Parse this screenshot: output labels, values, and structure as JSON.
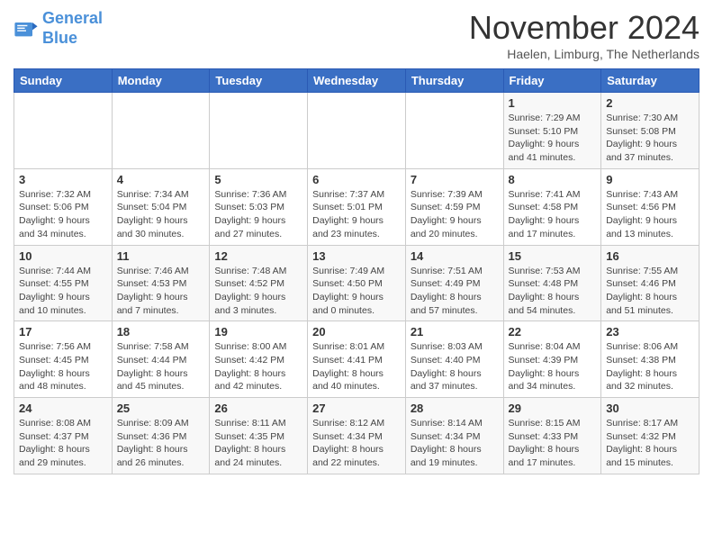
{
  "header": {
    "logo_line1": "General",
    "logo_line2": "Blue",
    "month_title": "November 2024",
    "location": "Haelen, Limburg, The Netherlands"
  },
  "days_of_week": [
    "Sunday",
    "Monday",
    "Tuesday",
    "Wednesday",
    "Thursday",
    "Friday",
    "Saturday"
  ],
  "weeks": [
    [
      {
        "day": "",
        "info": ""
      },
      {
        "day": "",
        "info": ""
      },
      {
        "day": "",
        "info": ""
      },
      {
        "day": "",
        "info": ""
      },
      {
        "day": "",
        "info": ""
      },
      {
        "day": "1",
        "info": "Sunrise: 7:29 AM\nSunset: 5:10 PM\nDaylight: 9 hours and 41 minutes."
      },
      {
        "day": "2",
        "info": "Sunrise: 7:30 AM\nSunset: 5:08 PM\nDaylight: 9 hours and 37 minutes."
      }
    ],
    [
      {
        "day": "3",
        "info": "Sunrise: 7:32 AM\nSunset: 5:06 PM\nDaylight: 9 hours and 34 minutes."
      },
      {
        "day": "4",
        "info": "Sunrise: 7:34 AM\nSunset: 5:04 PM\nDaylight: 9 hours and 30 minutes."
      },
      {
        "day": "5",
        "info": "Sunrise: 7:36 AM\nSunset: 5:03 PM\nDaylight: 9 hours and 27 minutes."
      },
      {
        "day": "6",
        "info": "Sunrise: 7:37 AM\nSunset: 5:01 PM\nDaylight: 9 hours and 23 minutes."
      },
      {
        "day": "7",
        "info": "Sunrise: 7:39 AM\nSunset: 4:59 PM\nDaylight: 9 hours and 20 minutes."
      },
      {
        "day": "8",
        "info": "Sunrise: 7:41 AM\nSunset: 4:58 PM\nDaylight: 9 hours and 17 minutes."
      },
      {
        "day": "9",
        "info": "Sunrise: 7:43 AM\nSunset: 4:56 PM\nDaylight: 9 hours and 13 minutes."
      }
    ],
    [
      {
        "day": "10",
        "info": "Sunrise: 7:44 AM\nSunset: 4:55 PM\nDaylight: 9 hours and 10 minutes."
      },
      {
        "day": "11",
        "info": "Sunrise: 7:46 AM\nSunset: 4:53 PM\nDaylight: 9 hours and 7 minutes."
      },
      {
        "day": "12",
        "info": "Sunrise: 7:48 AM\nSunset: 4:52 PM\nDaylight: 9 hours and 3 minutes."
      },
      {
        "day": "13",
        "info": "Sunrise: 7:49 AM\nSunset: 4:50 PM\nDaylight: 9 hours and 0 minutes."
      },
      {
        "day": "14",
        "info": "Sunrise: 7:51 AM\nSunset: 4:49 PM\nDaylight: 8 hours and 57 minutes."
      },
      {
        "day": "15",
        "info": "Sunrise: 7:53 AM\nSunset: 4:48 PM\nDaylight: 8 hours and 54 minutes."
      },
      {
        "day": "16",
        "info": "Sunrise: 7:55 AM\nSunset: 4:46 PM\nDaylight: 8 hours and 51 minutes."
      }
    ],
    [
      {
        "day": "17",
        "info": "Sunrise: 7:56 AM\nSunset: 4:45 PM\nDaylight: 8 hours and 48 minutes."
      },
      {
        "day": "18",
        "info": "Sunrise: 7:58 AM\nSunset: 4:44 PM\nDaylight: 8 hours and 45 minutes."
      },
      {
        "day": "19",
        "info": "Sunrise: 8:00 AM\nSunset: 4:42 PM\nDaylight: 8 hours and 42 minutes."
      },
      {
        "day": "20",
        "info": "Sunrise: 8:01 AM\nSunset: 4:41 PM\nDaylight: 8 hours and 40 minutes."
      },
      {
        "day": "21",
        "info": "Sunrise: 8:03 AM\nSunset: 4:40 PM\nDaylight: 8 hours and 37 minutes."
      },
      {
        "day": "22",
        "info": "Sunrise: 8:04 AM\nSunset: 4:39 PM\nDaylight: 8 hours and 34 minutes."
      },
      {
        "day": "23",
        "info": "Sunrise: 8:06 AM\nSunset: 4:38 PM\nDaylight: 8 hours and 32 minutes."
      }
    ],
    [
      {
        "day": "24",
        "info": "Sunrise: 8:08 AM\nSunset: 4:37 PM\nDaylight: 8 hours and 29 minutes."
      },
      {
        "day": "25",
        "info": "Sunrise: 8:09 AM\nSunset: 4:36 PM\nDaylight: 8 hours and 26 minutes."
      },
      {
        "day": "26",
        "info": "Sunrise: 8:11 AM\nSunset: 4:35 PM\nDaylight: 8 hours and 24 minutes."
      },
      {
        "day": "27",
        "info": "Sunrise: 8:12 AM\nSunset: 4:34 PM\nDaylight: 8 hours and 22 minutes."
      },
      {
        "day": "28",
        "info": "Sunrise: 8:14 AM\nSunset: 4:34 PM\nDaylight: 8 hours and 19 minutes."
      },
      {
        "day": "29",
        "info": "Sunrise: 8:15 AM\nSunset: 4:33 PM\nDaylight: 8 hours and 17 minutes."
      },
      {
        "day": "30",
        "info": "Sunrise: 8:17 AM\nSunset: 4:32 PM\nDaylight: 8 hours and 15 minutes."
      }
    ]
  ]
}
